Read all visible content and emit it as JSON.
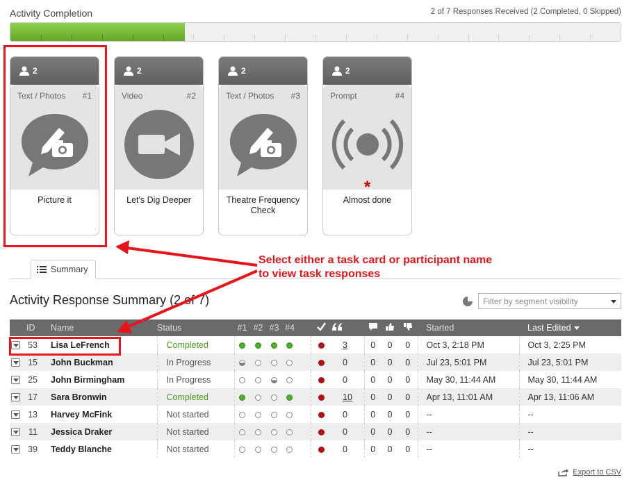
{
  "header": {
    "title": "Activity Completion",
    "responses": "2 of 7 Responses Received (2 Completed, 0 Skipped)"
  },
  "progress": {
    "completed": 2,
    "total": 7
  },
  "cards": [
    {
      "participants": "2",
      "type": "Text / Photos",
      "number": "#1",
      "name": "Picture it",
      "icon": "camera-pencil-icon",
      "required": false
    },
    {
      "participants": "2",
      "type": "Video",
      "number": "#2",
      "name": "Let's Dig Deeper",
      "icon": "video-camera-icon",
      "required": false
    },
    {
      "participants": "2",
      "type": "Text / Photos",
      "number": "#3",
      "name": "Theatre Frequency Check",
      "icon": "camera-pencil-icon",
      "required": false
    },
    {
      "participants": "2",
      "type": "Prompt",
      "number": "#4",
      "name": "Almost done",
      "icon": "broadcast-icon",
      "required": true,
      "required_mark": "*"
    }
  ],
  "annotation": {
    "line1": "Select either a task card or participant name",
    "line2": "to view task responses"
  },
  "tab": {
    "label": "Summary"
  },
  "summary": {
    "title": "Activity Response Summary (2 of 7)",
    "filter_placeholder": "Filter by segment visibility"
  },
  "table": {
    "headers": {
      "id": "ID",
      "name": "Name",
      "status": "Status",
      "t1": "#1",
      "t2": "#2",
      "t3": "#3",
      "t4": "#4",
      "started": "Started",
      "last_edited": "Last Edited"
    },
    "rows": [
      {
        "id": "53",
        "name": "Lisa LeFrench",
        "status": "Completed",
        "done": true,
        "tasks": [
          "full",
          "full",
          "full",
          "full"
        ],
        "quotes": "3",
        "quotes_link": true,
        "comments": "0",
        "likes": "0",
        "dislikes": "0",
        "started": "Oct 3, 2:18 PM",
        "last_edited": "Oct 3, 2:25 PM"
      },
      {
        "id": "15",
        "name": "John Buckman",
        "status": "In Progress",
        "done": false,
        "tasks": [
          "half",
          "empty",
          "empty",
          "empty"
        ],
        "quotes": "0",
        "quotes_link": false,
        "comments": "0",
        "likes": "0",
        "dislikes": "0",
        "started": "Jul 23, 5:01 PM",
        "last_edited": "Jul 23, 5:01 PM"
      },
      {
        "id": "25",
        "name": "John Birmingham",
        "status": "In Progress",
        "done": false,
        "tasks": [
          "empty",
          "empty",
          "half",
          "empty"
        ],
        "quotes": "0",
        "quotes_link": false,
        "comments": "0",
        "likes": "0",
        "dislikes": "0",
        "started": "May 30, 11:44 AM",
        "last_edited": "May 30, 11:44 AM"
      },
      {
        "id": "17",
        "name": "Sara Bronwin",
        "status": "Completed",
        "done": true,
        "tasks": [
          "full",
          "empty",
          "empty",
          "full"
        ],
        "quotes": "10",
        "quotes_link": true,
        "comments": "0",
        "likes": "0",
        "dislikes": "0",
        "started": "Apr 13, 11:01 AM",
        "last_edited": "Apr 13, 11:06 AM"
      },
      {
        "id": "13",
        "name": "Harvey McFink",
        "status": "Not started",
        "done": false,
        "tasks": [
          "empty",
          "empty",
          "empty",
          "empty"
        ],
        "quotes": "0",
        "quotes_link": false,
        "comments": "0",
        "likes": "0",
        "dislikes": "0",
        "started": "--",
        "last_edited": "--"
      },
      {
        "id": "11",
        "name": "Jessica Draker",
        "status": "Not started",
        "done": false,
        "tasks": [
          "empty",
          "empty",
          "empty",
          "empty"
        ],
        "quotes": "0",
        "quotes_link": false,
        "comments": "0",
        "likes": "0",
        "dislikes": "0",
        "started": "--",
        "last_edited": "--"
      },
      {
        "id": "39",
        "name": "Teddy Blanche",
        "status": "Not started",
        "done": false,
        "tasks": [
          "empty",
          "empty",
          "empty",
          "empty"
        ],
        "quotes": "0",
        "quotes_link": false,
        "comments": "0",
        "likes": "0",
        "dislikes": "0",
        "started": "--",
        "last_edited": "--"
      }
    ]
  },
  "export_label": "Export to CSV",
  "colors": {
    "accent_red": "#e8141b",
    "complete_green": "#4a9a1c",
    "progress_green": "#6fb832"
  }
}
